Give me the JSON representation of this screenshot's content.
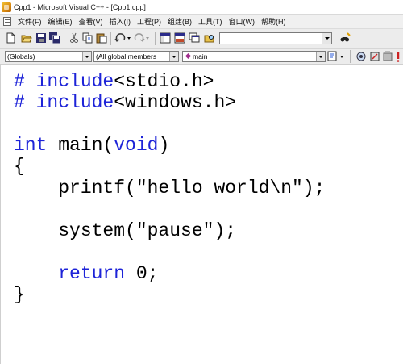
{
  "window": {
    "title": "Cpp1 - Microsoft Visual C++ - [Cpp1.cpp]"
  },
  "menu": {
    "items": [
      "文件(F)",
      "编辑(E)",
      "查看(V)",
      "插入(I)",
      "工程(P)",
      "组建(B)",
      "工具(T)",
      "窗口(W)",
      "帮助(H)"
    ]
  },
  "toolbar": {
    "icons": [
      "new-file-icon",
      "open-folder-icon",
      "save-icon",
      "save-all-icon",
      "cut-icon",
      "copy-icon",
      "paste-icon",
      "undo-icon",
      "redo-icon",
      "workspace-icon",
      "output-icon",
      "window-list-icon",
      "find-in-files-icon",
      "find-icon"
    ],
    "find_value": ""
  },
  "wizardbar": {
    "class_combo": "(Globals)",
    "filter_combo": "(All global members",
    "member_combo": "main"
  },
  "editor": {
    "lines": [
      [
        {
          "t": "# include",
          "k": true
        },
        {
          "t": "<stdio.h>",
          "k": false
        }
      ],
      [
        {
          "t": "# include",
          "k": true
        },
        {
          "t": "<windows.h>",
          "k": false
        }
      ],
      [],
      [
        {
          "t": "int",
          "k": true
        },
        {
          "t": " main(",
          "k": false
        },
        {
          "t": "void",
          "k": true
        },
        {
          "t": ")",
          "k": false
        }
      ],
      [
        {
          "t": "{",
          "k": false
        }
      ],
      [
        {
          "t": "    printf(\"hello world\\n\");",
          "k": false
        }
      ],
      [],
      [
        {
          "t": "    system(\"pause\");",
          "k": false
        }
      ],
      [],
      [
        {
          "t": "    ",
          "k": false
        },
        {
          "t": "return",
          "k": true
        },
        {
          "t": " 0;",
          "k": false
        }
      ],
      [
        {
          "t": "}",
          "k": false
        }
      ]
    ]
  },
  "colors": {
    "keyword": "#1d23d8",
    "text": "#000000"
  }
}
